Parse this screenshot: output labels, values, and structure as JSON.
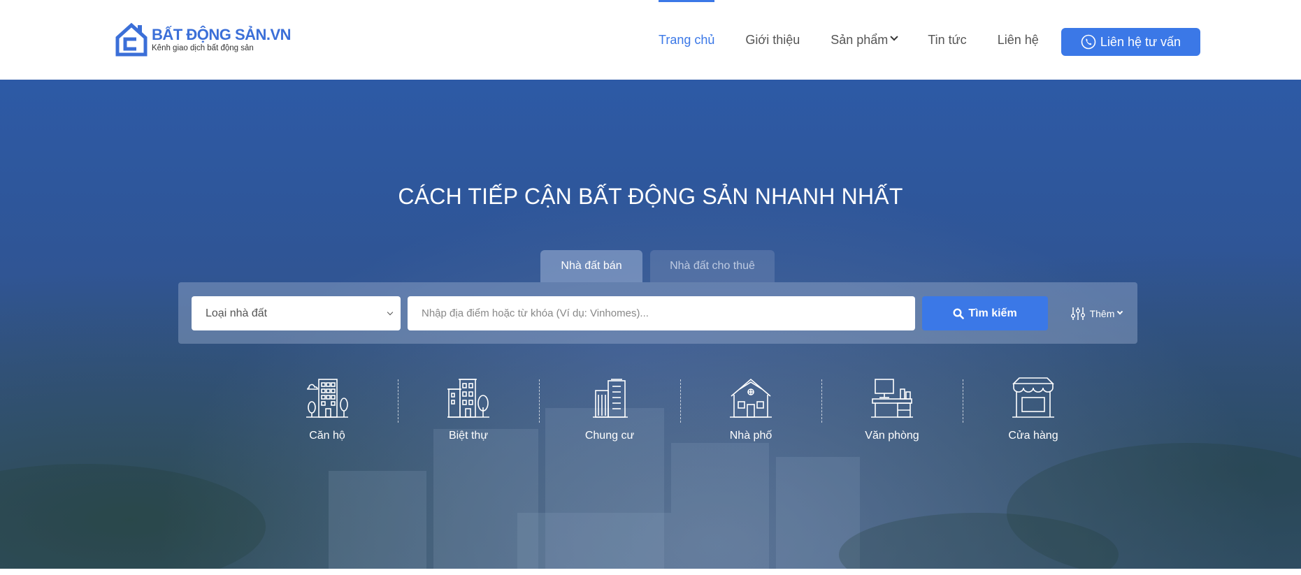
{
  "logo": {
    "title": "BẤT ĐỘNG SẢN.VN",
    "subtitle": "Kênh giao dịch bất động sản"
  },
  "nav": {
    "items": [
      {
        "label": "Trang chủ",
        "active": true
      },
      {
        "label": "Giới thiệu"
      },
      {
        "label": "Sản phẩm",
        "has_dropdown": true
      },
      {
        "label": "Tin tức"
      },
      {
        "label": "Liên hệ"
      }
    ],
    "cta_label": "Liên hệ tư vấn"
  },
  "hero": {
    "title": "CÁCH TIẾP CẬN BẤT ĐỘNG SẢN NHANH NHẤT"
  },
  "tabs": [
    {
      "label": "Nhà đất bán",
      "active": true
    },
    {
      "label": "Nhà đất cho thuê",
      "active": false
    }
  ],
  "search": {
    "type_select": "Loại nhà đất",
    "placeholder": "Nhập địa điểm hoặc từ khóa (Ví dụ: Vinhomes)...",
    "button_label": "Tìm kiếm",
    "more_label": "Thêm"
  },
  "categories": [
    {
      "label": "Căn hộ",
      "icon": "apartment-icon"
    },
    {
      "label": "Biệt thự",
      "icon": "villa-icon"
    },
    {
      "label": "Chung cư",
      "icon": "condominium-icon"
    },
    {
      "label": "Nhà phố",
      "icon": "townhouse-icon"
    },
    {
      "label": "Văn phòng",
      "icon": "office-icon"
    },
    {
      "label": "Cửa hàng",
      "icon": "store-icon"
    }
  ],
  "colors": {
    "brand": "#3b78e7",
    "hero_bg": "#2f5596",
    "text": "#555555"
  }
}
